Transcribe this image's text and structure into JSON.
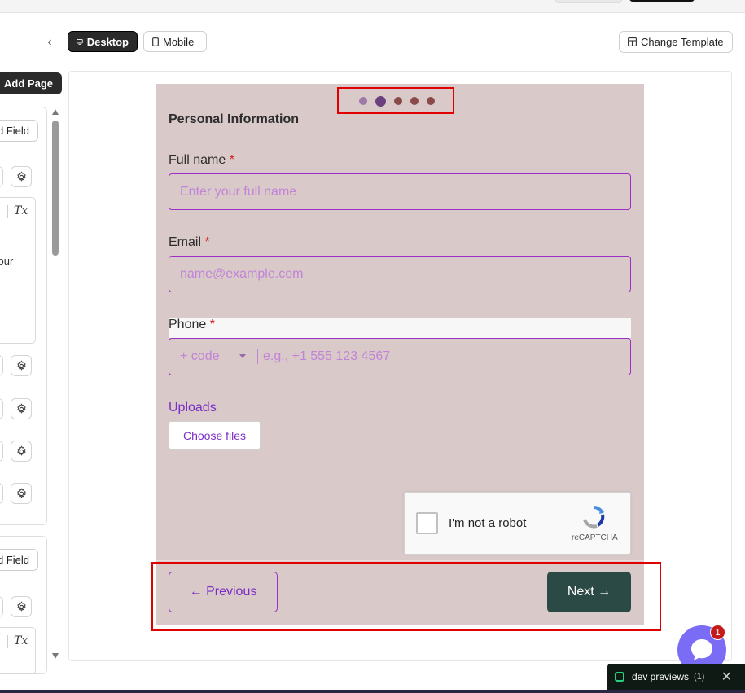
{
  "toolbar": {
    "desktop_label": "Desktop",
    "mobile_label": "Mobile",
    "change_template_label": "Change Template"
  },
  "sidebar": {
    "add_page_label": "Add Page",
    "add_field_label": "d Field",
    "editor_snippet": "your",
    "format_icon": "Tx"
  },
  "form": {
    "steps": {
      "total": 5,
      "current": 2
    },
    "section_title": "Personal Information",
    "full_name": {
      "label": "Full name",
      "required": "*",
      "placeholder": "Enter your full name"
    },
    "email": {
      "label": "Email",
      "required": "*",
      "placeholder": "name@example.com"
    },
    "phone": {
      "label": "Phone",
      "required": "*",
      "code_placeholder": "+ code",
      "placeholder": "e.g., +1 555 123 4567"
    },
    "uploads": {
      "label": "Uploads",
      "button_label": "Choose files"
    },
    "captcha": {
      "text": "I'm not a robot",
      "brand": "reCAPTCHA"
    },
    "nav": {
      "previous_label": "← Previous",
      "next_label": "Next →"
    }
  },
  "chat": {
    "badge_count": "1"
  },
  "dev_previews": {
    "label": "dev previews",
    "count": "(1)",
    "close": "✕"
  },
  "colors": {
    "form_background": "#d9c9c8",
    "accent_purple": "#9d2fc8",
    "next_button": "#2c4a45",
    "highlight_red": "#e00000"
  }
}
